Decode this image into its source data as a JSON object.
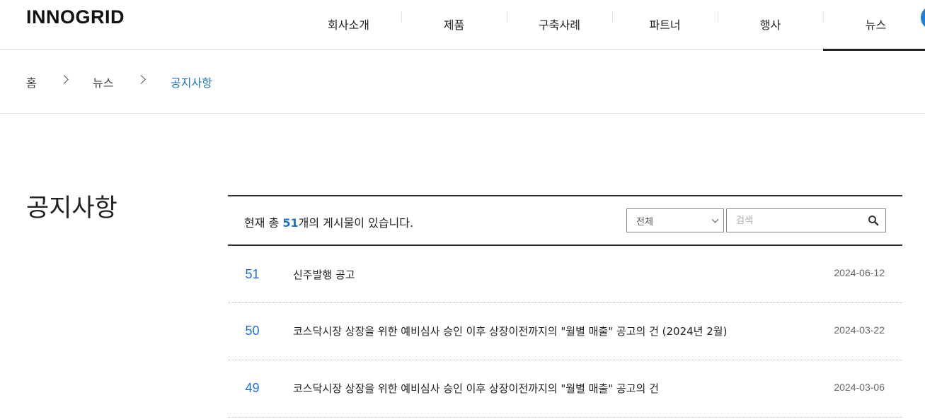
{
  "header": {
    "logo": "INNOGRID",
    "nav": [
      {
        "label": "회사소개"
      },
      {
        "label": "제품"
      },
      {
        "label": "구축사례"
      },
      {
        "label": "파트너"
      },
      {
        "label": "행사"
      },
      {
        "label": "뉴스",
        "active": true
      }
    ]
  },
  "breadcrumb": {
    "home": "홈",
    "news": "뉴스",
    "current": "공지사항"
  },
  "page_title": "공지사항",
  "board": {
    "count_prefix": "현재 총 ",
    "count": "51",
    "count_suffix": "개의 게시물이 있습니다.",
    "filter_selected": "전체",
    "search_placeholder": "검색",
    "posts": [
      {
        "num": "51",
        "title": "신주발행 공고",
        "date": "2024-06-12"
      },
      {
        "num": "50",
        "title": "코스닥시장 상장을 위한 예비심사 승인 이후 상장이전까지의 \"월별 매출\" 공고의 건 (2024년 2월)",
        "date": "2024-03-22"
      },
      {
        "num": "49",
        "title": "코스닥시장 상장을 위한 예비심사 승인 이후 상장이전까지의 \"월별 매출\" 공고의 건",
        "date": "2024-03-06"
      }
    ]
  },
  "colors": {
    "accent": "#1e6fd0",
    "breadcrumb_current": "#1e73be"
  }
}
